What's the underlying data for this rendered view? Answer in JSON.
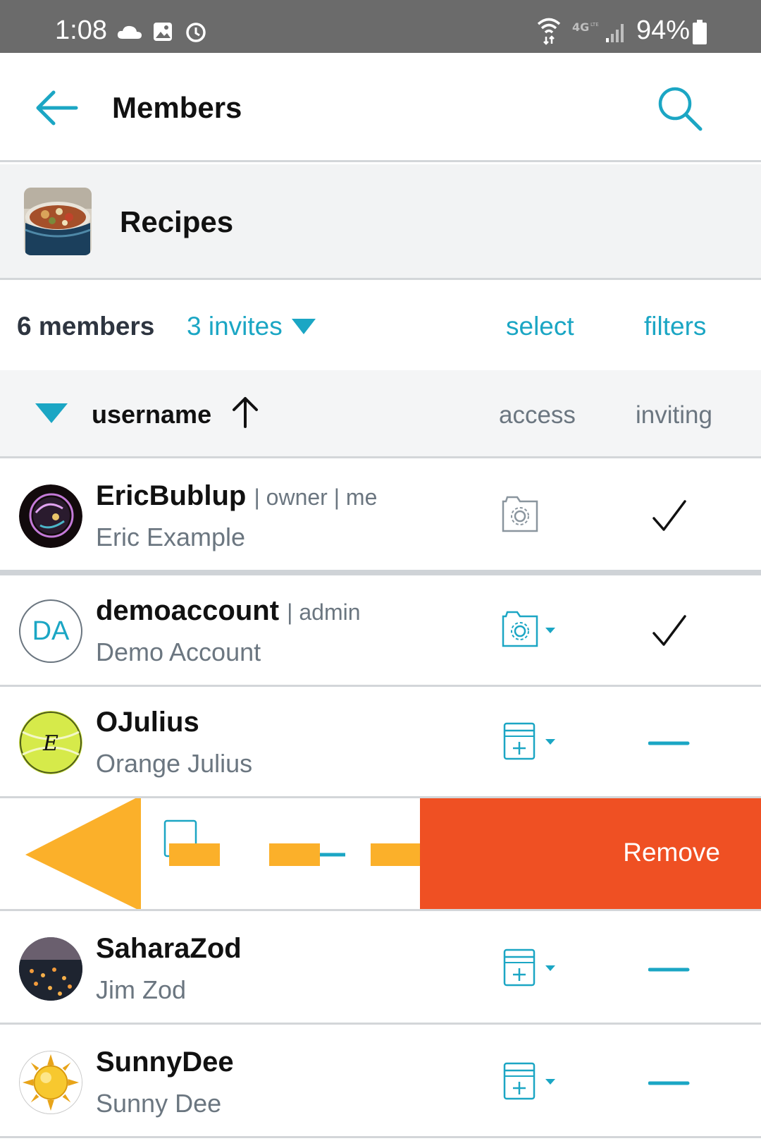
{
  "status_bar": {
    "time": "1:08",
    "battery": "94%",
    "icons": [
      "cloud-icon",
      "image-icon",
      "alarm-icon",
      "wifi-icon",
      "4g-lte-icon",
      "signal-icon",
      "battery-icon"
    ]
  },
  "app_bar": {
    "title": "Members",
    "back_icon": "arrow-left-icon",
    "search_icon": "search-icon"
  },
  "group": {
    "name": "Recipes"
  },
  "summary": {
    "members": "6 members",
    "invites": "3 invites",
    "select": "select",
    "filters": "filters"
  },
  "columns": {
    "username": "username",
    "access": "access",
    "inviting": "inviting"
  },
  "members": [
    {
      "username": "EricBublup",
      "role": "| owner | me",
      "name": "Eric Example",
      "access": "admin-folder-gear-icon",
      "inviting": "check-icon"
    },
    {
      "username": "demoaccount",
      "role": "| admin",
      "name": "Demo Account",
      "avatar_initials": "DA",
      "access": "admin-folder-gear-icon",
      "inviting": "check-icon"
    },
    {
      "username": "OJulius",
      "role": "",
      "name": "Orange Julius",
      "access": "add-item-icon",
      "inviting": "dash-icon"
    },
    {
      "username": "SaharaZod",
      "role": "",
      "name": "Jim Zod",
      "access": "add-item-icon",
      "inviting": "dash-icon"
    },
    {
      "username": "SunnyDee",
      "role": "",
      "name": "Sunny Dee",
      "access": "add-item-icon",
      "inviting": "dash-icon"
    }
  ],
  "swipe_row": {
    "remove_label": "Remove"
  },
  "colors": {
    "accent": "#1ba6c4",
    "remove": "#ef5023",
    "swipe_hint": "#fbb02a",
    "status_bar": "#6b6b6b"
  }
}
